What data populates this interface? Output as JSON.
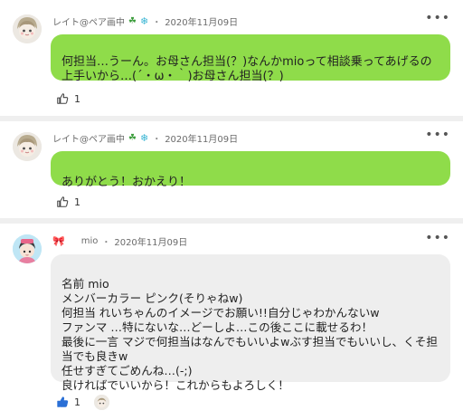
{
  "posts": [
    {
      "author": "レイト@ペア画中",
      "date": "2020年11月09日",
      "text": "何担当…うーん。お母さん担当(？)なんかmioって相談乗ってあげるの上手いから…(´・ω・｀)お母さん担当(？)",
      "likes": "1"
    },
    {
      "author": "レイト@ペア画中",
      "date": "2020年11月09日",
      "text": "ありがとう！おかえり！",
      "likes": "1"
    },
    {
      "author": "mio",
      "date": "2020年11月09日",
      "text": "名前 mio\nメンバーカラー ピンク(そりゃねw)\n何担当 れいちゃんのイメージでお願い!!自分じゃわかんないw\nファンマ …特にないな…どーしよ…この後ここに載せるわ！\n最後に一言 マジで何担当はなんでもいいよwぶす担当でもいいし、くそ担当でも良きw\n任せすぎてごめんね…(-;)\n良ければでいいから！これからもよろしく！",
      "likes": "1"
    }
  ],
  "meta_separator": "・",
  "more_glyph": "•••",
  "colors": {
    "bubble_green": "#8fdc4a",
    "bubble_gray": "#eeeeee",
    "like_active": "#2a6fd6"
  },
  "icons": [
    "clover-icon",
    "snowflake-icon",
    "thumbs-up-icon",
    "more-icon",
    "ribbon-icon"
  ]
}
